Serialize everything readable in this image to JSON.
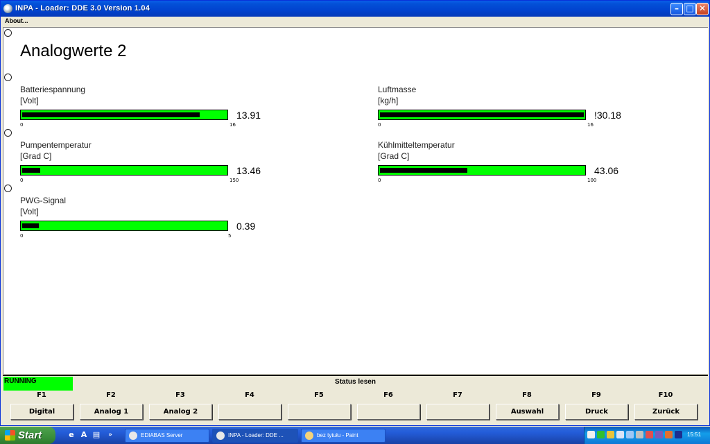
{
  "window": {
    "title": "INPA - Loader:  DDE 3.0 Version 1.04",
    "minimize": "–",
    "maximize": "□",
    "close": "✕"
  },
  "menu": {
    "about": "About..."
  },
  "page": {
    "title": "Analogwerte 2"
  },
  "gauges": [
    {
      "label": "Batteriespannung",
      "unit": "[Volt]",
      "value": "13.91",
      "min": "0",
      "max": "16",
      "fill_fraction": 0.87
    },
    {
      "label": "Luftmasse",
      "unit": "[kg/h]",
      "value": "!30.18",
      "min": "0",
      "max": "16",
      "fill_fraction": 1.0
    },
    {
      "label": "Pumpentemperatur",
      "unit": "[Grad C]",
      "value": "13.46",
      "min": "0",
      "max": "150",
      "fill_fraction": 0.09
    },
    {
      "label": "Kühlmitteltemperatur",
      "unit": "[Grad C]",
      "value": "43.06",
      "min": "0",
      "max": "100",
      "fill_fraction": 0.43
    },
    {
      "label": "PWG-Signal",
      "unit": "[Volt]",
      "value": "0.39",
      "min": "0",
      "max": "5",
      "fill_fraction": 0.08
    }
  ],
  "status": {
    "state": "RUNNING",
    "text": "Status lesen",
    "state_color": "#00ff00"
  },
  "fkeys": [
    {
      "key": "F1",
      "label": "Digital"
    },
    {
      "key": "F2",
      "label": "Analog 1"
    },
    {
      "key": "F3",
      "label": "Analog 2"
    },
    {
      "key": "F4",
      "label": ""
    },
    {
      "key": "F5",
      "label": ""
    },
    {
      "key": "F6",
      "label": ""
    },
    {
      "key": "F7",
      "label": ""
    },
    {
      "key": "F8",
      "label": "Auswahl"
    },
    {
      "key": "F9",
      "label": "Druck"
    },
    {
      "key": "F10",
      "label": "Zurück"
    }
  ],
  "taskbar": {
    "start": "Start",
    "quicklaunch_more": "»",
    "tasks": [
      "EDIABAS Server",
      "INPA - Loader:  DDE ...",
      "bez tytułu - Paint"
    ],
    "clock": "15:51"
  },
  "colors": {
    "bar_green": "#00ff00",
    "bar_fill": "#000000",
    "titlebar": "#0350d7"
  }
}
